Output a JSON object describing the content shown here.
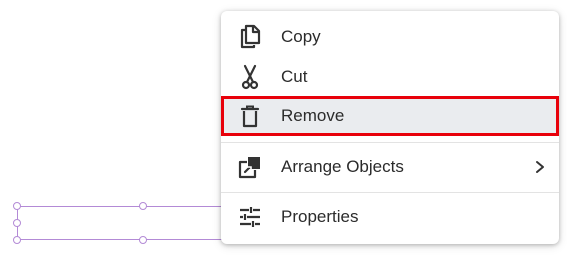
{
  "menu": {
    "items": [
      {
        "label": "Copy",
        "icon": "copy-icon"
      },
      {
        "label": "Cut",
        "icon": "scissors-icon"
      },
      {
        "label": "Remove",
        "icon": "trash-icon",
        "state": "hovered"
      },
      {
        "label": "Arrange Objects",
        "icon": "arrange-objects-icon",
        "submenu_indicator": "chevron-right-icon"
      },
      {
        "label": "Properties",
        "icon": "sliders-icon"
      }
    ]
  },
  "colors": {
    "highlight_border": "#e8000a",
    "highlight_background": "#eaecef",
    "selection": "#b38ad6",
    "text": "#2b2b2b"
  }
}
